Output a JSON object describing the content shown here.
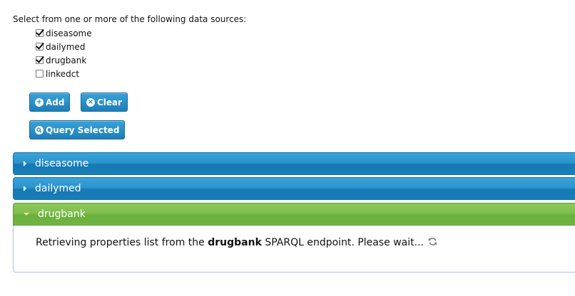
{
  "intro": "Select from one or more of the following data sources:",
  "sources": [
    {
      "label": "diseasome",
      "checked": true
    },
    {
      "label": "dailymed",
      "checked": true
    },
    {
      "label": "drugbank",
      "checked": true
    },
    {
      "label": "linkedct",
      "checked": false
    }
  ],
  "buttons": {
    "add": {
      "label": "Add",
      "icon": "plus-circle-icon"
    },
    "clear": {
      "label": "Clear",
      "icon": "x-circle-icon"
    },
    "query": {
      "label": "Query Selected",
      "icon": "search-circle-icon"
    }
  },
  "accordion": {
    "panels": [
      {
        "title": "diseasome",
        "expanded": false
      },
      {
        "title": "dailymed",
        "expanded": false
      },
      {
        "title": "drugbank",
        "expanded": true
      }
    ],
    "body": {
      "prefix": "Retrieving properties list from the ",
      "source": "drugbank",
      "suffix": " SPARQL endpoint. Please wait...",
      "icon": "refresh-icon"
    }
  },
  "colors": {
    "button_blue": "#1d7fb8",
    "panel_blue": "#2c93cd",
    "panel_green": "#7fbe4d"
  }
}
